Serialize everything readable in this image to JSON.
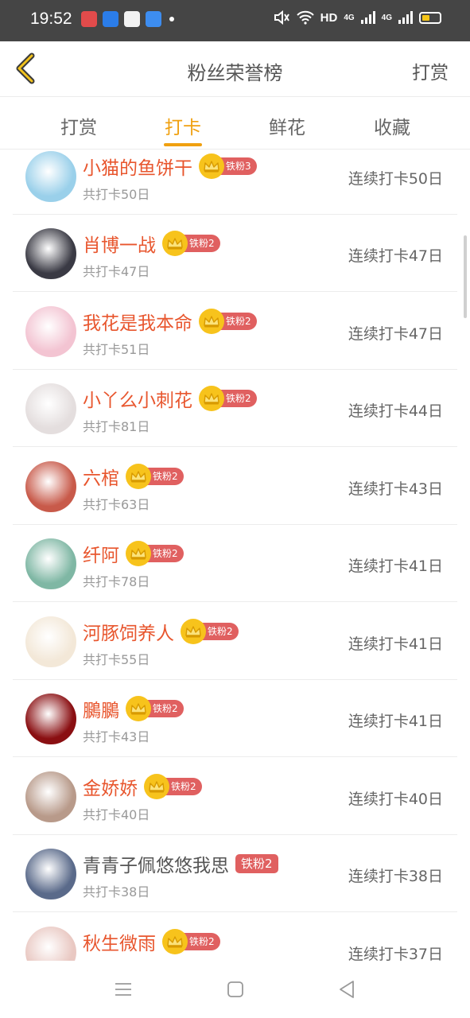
{
  "status_bar": {
    "time": "19:52",
    "network_label": "HD",
    "signal1": "4G",
    "signal2": "4G"
  },
  "header": {
    "title": "粉丝荣誉榜",
    "right_action": "打赏",
    "back_icon": "chevron-left-icon",
    "accent_color": "#f0a010"
  },
  "tabs": [
    {
      "label": "打赏",
      "active": false
    },
    {
      "label": "打卡",
      "active": true
    },
    {
      "label": "鲜花",
      "active": false
    },
    {
      "label": "收藏",
      "active": false
    }
  ],
  "list": [
    {
      "name": "小猫的鱼饼干",
      "badge": "铁粉3",
      "crown": true,
      "total": "共打卡50日",
      "streak": "连续打卡50日",
      "avatar_color": "#9ad0ea"
    },
    {
      "name": "肖博一战",
      "badge": "铁粉2",
      "crown": true,
      "total": "共打卡47日",
      "streak": "连续打卡47日",
      "avatar_color": "#3a3a44"
    },
    {
      "name": "我花是我本命",
      "badge": "铁粉2",
      "crown": true,
      "total": "共打卡51日",
      "streak": "连续打卡47日",
      "avatar_color": "#f3c4d2"
    },
    {
      "name": "小丫么小刺花",
      "badge": "铁粉2",
      "crown": true,
      "total": "共打卡81日",
      "streak": "连续打卡44日",
      "avatar_color": "#e4dede"
    },
    {
      "name": "六棺",
      "badge": "铁粉2",
      "crown": true,
      "total": "共打卡63日",
      "streak": "连续打卡43日",
      "avatar_color": "#c85a4a"
    },
    {
      "name": "纤阿",
      "badge": "铁粉2",
      "crown": true,
      "total": "共打卡78日",
      "streak": "连续打卡41日",
      "avatar_color": "#7fb7a4"
    },
    {
      "name": "河豚饲养人",
      "badge": "铁粉2",
      "crown": true,
      "total": "共打卡55日",
      "streak": "连续打卡41日",
      "avatar_color": "#f3e8d8"
    },
    {
      "name": "鵩鵩",
      "badge": "铁粉2",
      "crown": true,
      "total": "共打卡43日",
      "streak": "连续打卡41日",
      "avatar_color": "#8a0f12"
    },
    {
      "name": "金娇娇",
      "badge": "铁粉2",
      "crown": true,
      "total": "共打卡40日",
      "streak": "连续打卡40日",
      "avatar_color": "#b89a8a"
    },
    {
      "name": "青青子佩悠悠我思",
      "badge": "铁粉2",
      "crown": false,
      "total": "共打卡38日",
      "streak": "连续打卡38日",
      "avatar_color": "#5a6a8a"
    },
    {
      "name": "秋生微雨",
      "badge": "铁粉2",
      "crown": true,
      "total": "",
      "streak": "连续打卡37日",
      "avatar_color": "#e9c8c2"
    }
  ],
  "nav": {
    "menu_icon": "menu-icon",
    "home_icon": "home-square-icon",
    "back_icon": "back-triangle-icon"
  }
}
